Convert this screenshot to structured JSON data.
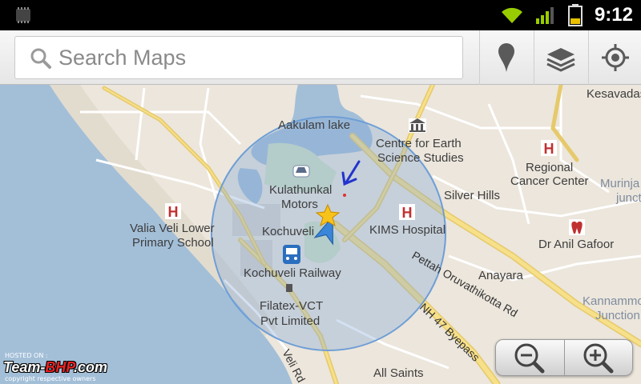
{
  "status_bar": {
    "time": "9:12",
    "icons": [
      "sd-card-icon",
      "wifi-icon",
      "signal-icon",
      "battery-icon"
    ]
  },
  "search": {
    "placeholder": "Search Maps",
    "buttons": [
      "place-pin-icon",
      "layers-icon",
      "my-location-icon"
    ]
  },
  "map": {
    "water_color": "#a3bfd8",
    "land_color": "#ece6dc",
    "accuracy_circle_color": "#6e9ed6",
    "labels": {
      "kesavadas": "Kesavadas",
      "aakulam_lake": "Aakulam lake",
      "centre_earth_1": "Centre for Earth",
      "centre_earth_2": "Science Studies",
      "regional_cancer_1": "Regional",
      "regional_cancer_2": "Cancer Center",
      "murinja": "Murinja",
      "junct": "junct",
      "kulathunkal_1": "Kulathunkal",
      "kulathunkal_2": "Motors",
      "silver_hills": "Silver Hills",
      "valia_veli_1": "Valia Veli Lower",
      "valia_veli_2": "Primary School",
      "kochuveli": "Kochuveli",
      "kims": "KIMS Hospital",
      "dr_anil": "Dr Anil Gafoor",
      "kochuveli_railway": "Kochuveli Railway",
      "anayara": "Anayara",
      "filatex_1": "Filatex-VCT",
      "filatex_2": "Pvt Limited",
      "kannammoola": "Kannammo",
      "junction": "Junction",
      "pettah_road": "Pettah Oruvathikotta Rd",
      "nh47": "NH 47 Byepass",
      "veli_rd": "Veli Rd",
      "all_saints": "All Saints"
    }
  },
  "zoom": {
    "out": "zoom-out-icon",
    "in": "zoom-in-icon"
  },
  "watermark": {
    "hosted": "HOSTED ON :",
    "brand_1": "Team-",
    "brand_2": "BHP",
    "brand_3": ".com",
    "copyright": "copyright respective owners"
  }
}
